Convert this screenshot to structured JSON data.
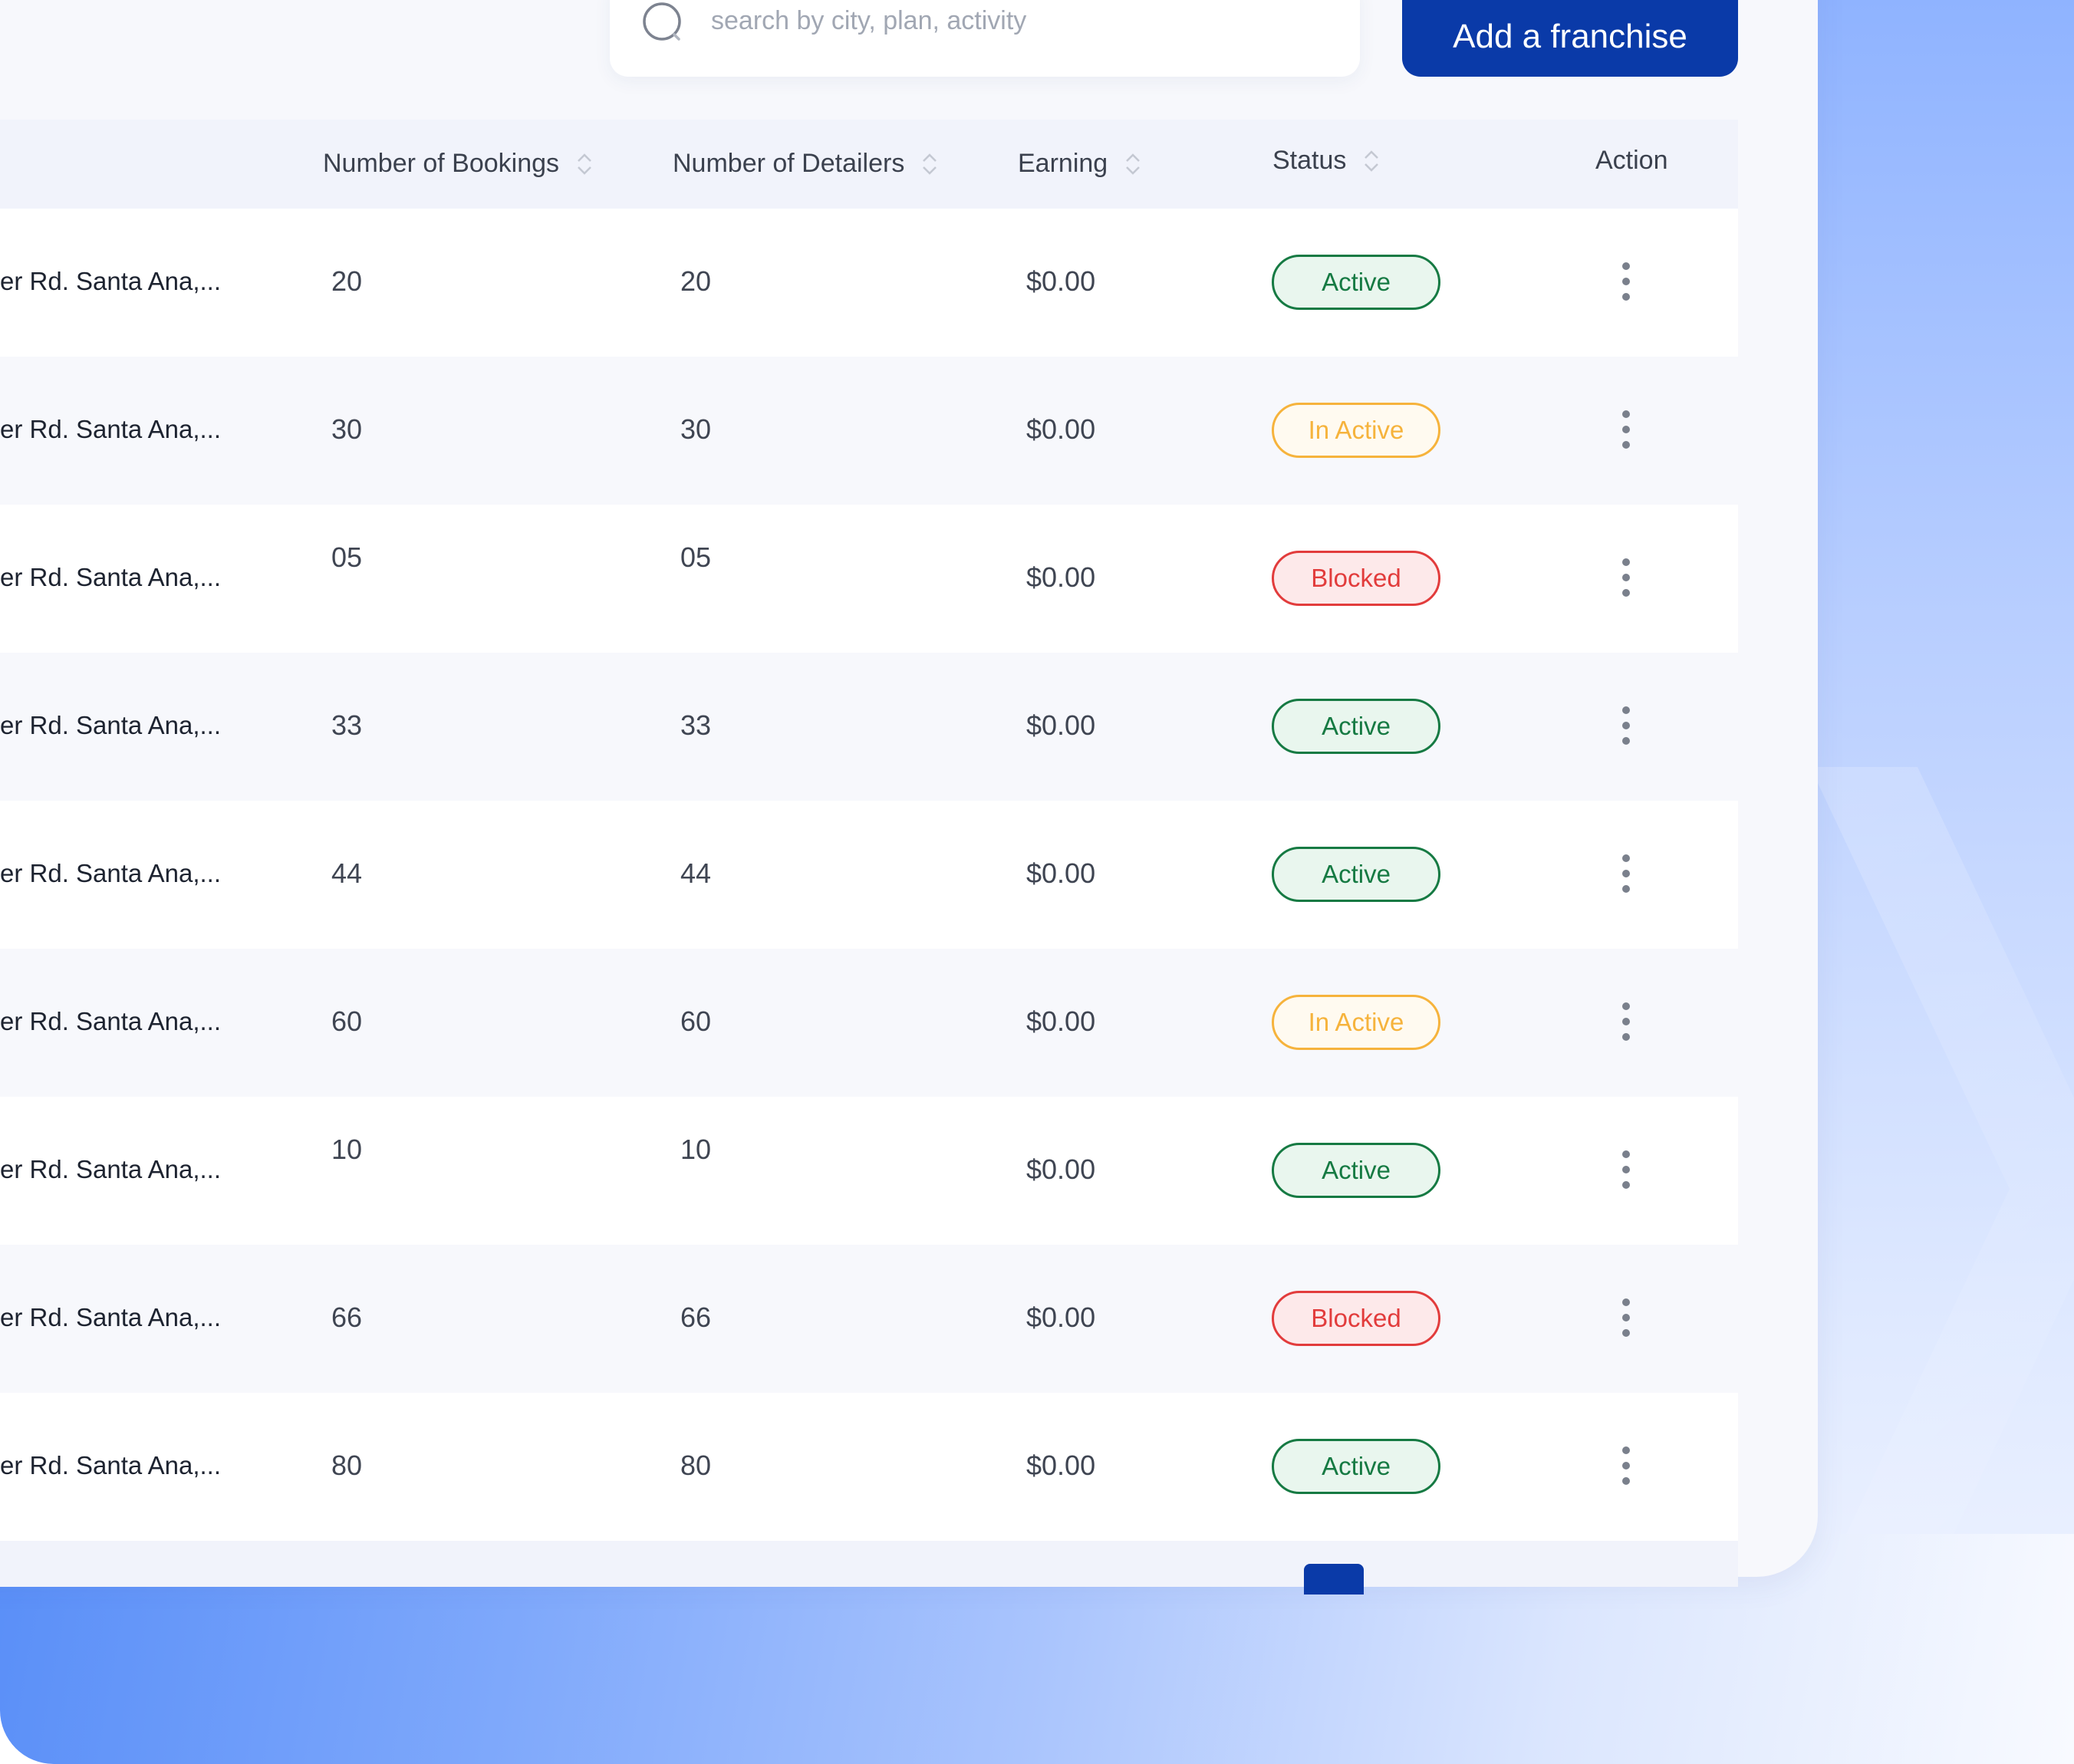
{
  "search": {
    "placeholder": "search by city, plan, activity"
  },
  "toolbar": {
    "add_label": "Add a franchise"
  },
  "columns": {
    "bookings": "Number of  Bookings",
    "detailers": "Number of  Detailers",
    "earning": "Earning",
    "status": "Status",
    "action": "Action"
  },
  "rows": [
    {
      "address": "er Rd. Santa Ana,...",
      "bookings": "20",
      "detailers": "20",
      "earning": "$0.00",
      "status": "Active"
    },
    {
      "address": "er Rd. Santa Ana,...",
      "bookings": "30",
      "detailers": "30",
      "earning": "$0.00",
      "status": "In Active"
    },
    {
      "address": "er Rd. Santa Ana,...",
      "bookings": "05",
      "detailers": "05",
      "earning": "$0.00",
      "status": "Blocked"
    },
    {
      "address": "er Rd. Santa Ana,...",
      "bookings": "33",
      "detailers": "33",
      "earning": "$0.00",
      "status": "Active"
    },
    {
      "address": "er Rd. Santa Ana,...",
      "bookings": "44",
      "detailers": "44",
      "earning": "$0.00",
      "status": "Active"
    },
    {
      "address": "er Rd. Santa Ana,...",
      "bookings": "60",
      "detailers": "60",
      "earning": "$0.00",
      "status": "In Active"
    },
    {
      "address": "er Rd. Santa Ana,...",
      "bookings": "10",
      "detailers": "10",
      "earning": "$0.00",
      "status": "Active"
    },
    {
      "address": "er Rd. Santa Ana,...",
      "bookings": "66",
      "detailers": "66",
      "earning": "$0.00",
      "status": "Blocked"
    },
    {
      "address": "er Rd. Santa Ana,...",
      "bookings": "80",
      "detailers": "80",
      "earning": "$0.00",
      "status": "Active"
    }
  ],
  "colors": {
    "brand": "#0a3aa8",
    "active": "#167a43",
    "inactive": "#f6b33c",
    "blocked": "#e23c3c"
  },
  "icons": {
    "search": "search-icon",
    "sort": "sort-icon",
    "action": "kebab-menu-icon"
  }
}
